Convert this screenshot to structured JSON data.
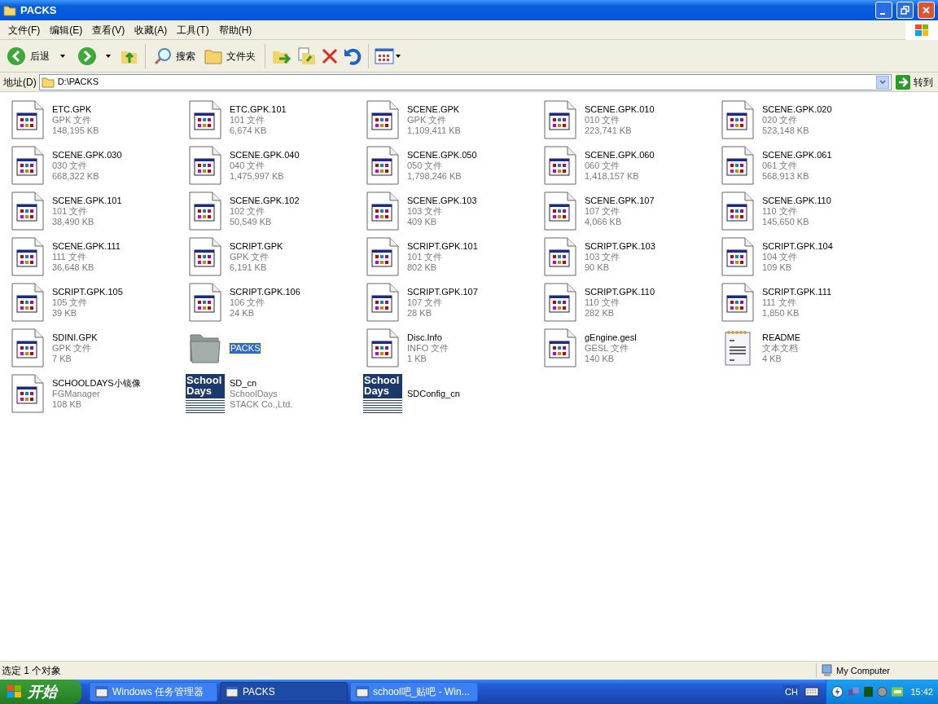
{
  "window": {
    "title": "PACKS"
  },
  "menu": [
    "文件(F)",
    "编辑(E)",
    "查看(V)",
    "收藏(A)",
    "工具(T)",
    "帮助(H)"
  ],
  "toolbar": {
    "back": "后退",
    "search": "搜索",
    "folders": "文件夹"
  },
  "address": {
    "label": "地址(D)",
    "value": "D:\\PACKS",
    "go": "转到"
  },
  "files": [
    {
      "kind": "file",
      "name": "ETC.GPK",
      "type": "GPK 文件",
      "size": "148,195 KB",
      "selected": false
    },
    {
      "kind": "file",
      "name": "ETC.GPK.101",
      "type": "101 文件",
      "size": "6,674 KB",
      "selected": false
    },
    {
      "kind": "file",
      "name": "SCENE.GPK",
      "type": "GPK 文件",
      "size": "1,109,411 KB",
      "selected": false
    },
    {
      "kind": "file",
      "name": "SCENE.GPK.010",
      "type": "010 文件",
      "size": "223,741 KB",
      "selected": false
    },
    {
      "kind": "file",
      "name": "SCENE.GPK.020",
      "type": "020 文件",
      "size": "523,148 KB",
      "selected": false
    },
    {
      "kind": "file",
      "name": "SCENE.GPK.030",
      "type": "030 文件",
      "size": "668,322 KB",
      "selected": false
    },
    {
      "kind": "file",
      "name": "SCENE.GPK.040",
      "type": "040 文件",
      "size": "1,475,997 KB",
      "selected": false
    },
    {
      "kind": "file",
      "name": "SCENE.GPK.050",
      "type": "050 文件",
      "size": "1,798,246 KB",
      "selected": false
    },
    {
      "kind": "file",
      "name": "SCENE.GPK.060",
      "type": "060 文件",
      "size": "1,418,157 KB",
      "selected": false
    },
    {
      "kind": "file",
      "name": "SCENE.GPK.061",
      "type": "061 文件",
      "size": "568,913 KB",
      "selected": false
    },
    {
      "kind": "file",
      "name": "SCENE.GPK.101",
      "type": "101 文件",
      "size": "38,490 KB",
      "selected": false
    },
    {
      "kind": "file",
      "name": "SCENE.GPK.102",
      "type": "102 文件",
      "size": "50,549 KB",
      "selected": false
    },
    {
      "kind": "file",
      "name": "SCENE.GPK.103",
      "type": "103 文件",
      "size": "409 KB",
      "selected": false
    },
    {
      "kind": "file",
      "name": "SCENE.GPK.107",
      "type": "107 文件",
      "size": "4,066 KB",
      "selected": false
    },
    {
      "kind": "file",
      "name": "SCENE.GPK.110",
      "type": "110 文件",
      "size": "145,650 KB",
      "selected": false
    },
    {
      "kind": "file",
      "name": "SCENE.GPK.111",
      "type": "111 文件",
      "size": "36,648 KB",
      "selected": false
    },
    {
      "kind": "file",
      "name": "SCRIPT.GPK",
      "type": "GPK 文件",
      "size": "6,191 KB",
      "selected": false
    },
    {
      "kind": "file",
      "name": "SCRIPT.GPK.101",
      "type": "101 文件",
      "size": "802 KB",
      "selected": false
    },
    {
      "kind": "file",
      "name": "SCRIPT.GPK.103",
      "type": "103 文件",
      "size": "90 KB",
      "selected": false
    },
    {
      "kind": "file",
      "name": "SCRIPT.GPK.104",
      "type": "104 文件",
      "size": "109 KB",
      "selected": false
    },
    {
      "kind": "file",
      "name": "SCRIPT.GPK.105",
      "type": "105 文件",
      "size": "39 KB",
      "selected": false
    },
    {
      "kind": "file",
      "name": "SCRIPT.GPK.106",
      "type": "106 文件",
      "size": "24 KB",
      "selected": false
    },
    {
      "kind": "file",
      "name": "SCRIPT.GPK.107",
      "type": "107 文件",
      "size": "28 KB",
      "selected": false
    },
    {
      "kind": "file",
      "name": "SCRIPT.GPK.110",
      "type": "110 文件",
      "size": "282 KB",
      "selected": false
    },
    {
      "kind": "file",
      "name": "SCRIPT.GPK.111",
      "type": "111 文件",
      "size": "1,850 KB",
      "selected": false
    },
    {
      "kind": "file",
      "name": "SDINI.GPK",
      "type": "GPK 文件",
      "size": "7 KB",
      "selected": false
    },
    {
      "kind": "folder",
      "name": "PACKS",
      "selected": true
    },
    {
      "kind": "file",
      "name": "Disc.Info",
      "type": "INFO 文件",
      "size": "1 KB",
      "selected": false
    },
    {
      "kind": "file",
      "name": "gEngine.gesl",
      "type": "GESL 文件",
      "size": "140 KB",
      "selected": false
    },
    {
      "kind": "text",
      "name": "README",
      "type": "文本文档",
      "size": "4 KB",
      "selected": false
    },
    {
      "kind": "file",
      "name": "SCHOOLDAYS小镜像",
      "type": "FGManager",
      "size": "108 KB",
      "selected": false
    },
    {
      "kind": "logo",
      "logo_lines": [
        "School",
        "Days"
      ],
      "name": "SD_cn",
      "type": "SchoolDays",
      "size": "STACK Co.,Ltd.",
      "selected": false
    },
    {
      "kind": "logo",
      "logo_lines": [
        "School",
        "Days"
      ],
      "name": "SDConfig_cn",
      "selected": false
    }
  ],
  "status_bar": {
    "text": "选定 1 个对象",
    "zone": "My Computer"
  },
  "taskbar": {
    "start": "开始",
    "tasks": [
      {
        "label": "Windows 任务管理器",
        "selected": false
      },
      {
        "label": "PACKS",
        "selected": true
      },
      {
        "label": "school吧_贴吧 - Win...",
        "selected": false
      }
    ],
    "lang": "CH",
    "clock": "15:42"
  }
}
